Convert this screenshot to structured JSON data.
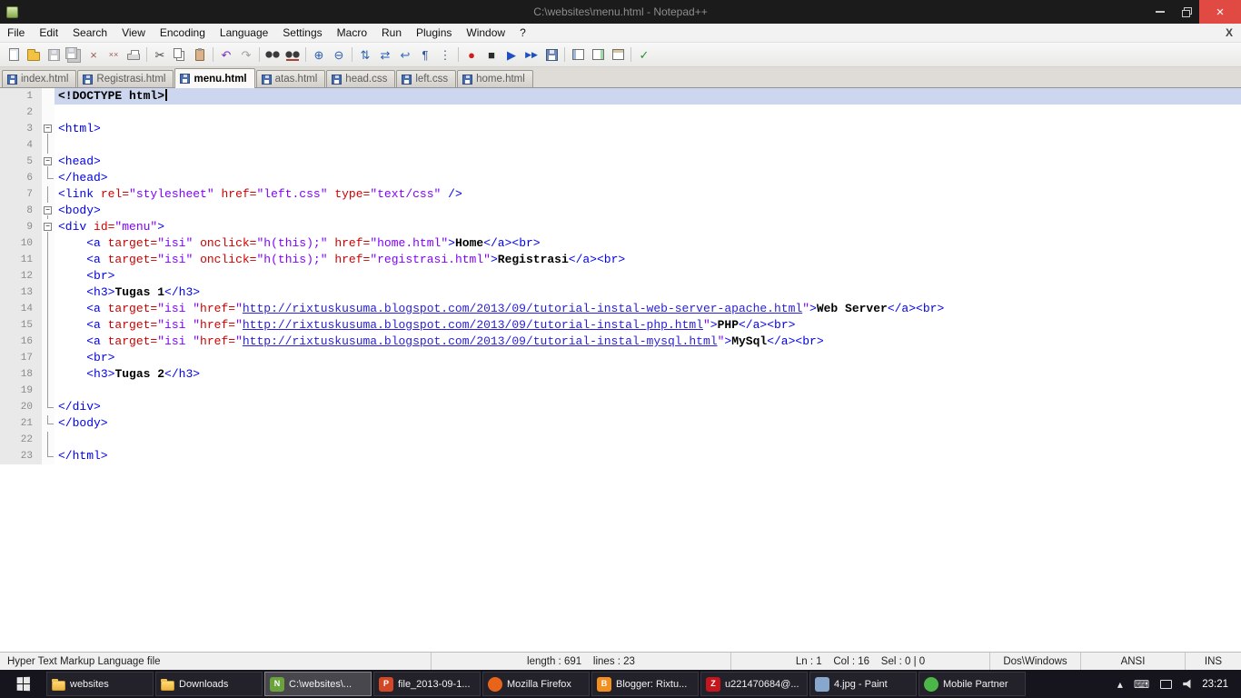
{
  "window": {
    "title": "C:\\websites\\menu.html - Notepad++",
    "menu_close_label": "X"
  },
  "menu": {
    "items": [
      "File",
      "Edit",
      "Search",
      "View",
      "Encoding",
      "Language",
      "Settings",
      "Macro",
      "Run",
      "Plugins",
      "Window",
      "?"
    ]
  },
  "toolbar": {
    "icons": [
      {
        "n": "new-file-icon",
        "s": "page"
      },
      {
        "n": "open-file-icon",
        "s": "folder"
      },
      {
        "n": "save-icon",
        "s": "floppy-gray"
      },
      {
        "n": "save-all-icon",
        "s": "floppy2-gray"
      },
      {
        "n": "close-file-icon",
        "g": "×",
        "c": "#a05a5a"
      },
      {
        "n": "close-all-files-icon",
        "g": "××",
        "c": "#a05a5a"
      },
      {
        "n": "print-icon",
        "s": "printer"
      },
      {
        "sep": true
      },
      {
        "n": "cut-icon",
        "g": "✂",
        "c": "#444444"
      },
      {
        "n": "copy-icon",
        "s": "copy"
      },
      {
        "n": "paste-icon",
        "s": "clipboard"
      },
      {
        "sep": true
      },
      {
        "n": "undo-icon",
        "g": "↶",
        "c": "#7b2fbe"
      },
      {
        "n": "redo-icon",
        "g": "↷",
        "c": "#a0a0a0"
      },
      {
        "sep": true
      },
      {
        "n": "find-icon",
        "s": "binoc"
      },
      {
        "n": "replace-icon",
        "s": "binoc2"
      },
      {
        "sep": true
      },
      {
        "n": "zoom-in-icon",
        "g": "⊕",
        "c": "#2b5fb4"
      },
      {
        "n": "zoom-out-icon",
        "g": "⊖",
        "c": "#2b5fb4"
      },
      {
        "sep": true
      },
      {
        "n": "sync-vertical-icon",
        "g": "⇅",
        "c": "#2b5fb4"
      },
      {
        "n": "sync-horizontal-icon",
        "g": "⇄",
        "c": "#2b5fb4"
      },
      {
        "n": "word-wrap-icon",
        "g": "↩",
        "c": "#356ac0"
      },
      {
        "n": "show-all-characters-icon",
        "g": "¶",
        "c": "#35589a"
      },
      {
        "n": "indent-guide-icon",
        "g": "⋮",
        "c": "#35589a"
      },
      {
        "sep": true
      },
      {
        "n": "start-recording-icon",
        "g": "●",
        "c": "#cf1d1d"
      },
      {
        "n": "stop-recording-icon",
        "g": "■",
        "c": "#2b2b2b"
      },
      {
        "n": "playback-macro-icon",
        "g": "▶",
        "c": "#1d4fc0"
      },
      {
        "n": "run-macro-multiple-icon",
        "g": "▶▶",
        "c": "#1d4fc0"
      },
      {
        "n": "save-macro-icon",
        "s": "floppy"
      },
      {
        "sep": true
      },
      {
        "n": "function-list-icon",
        "s": "panel"
      },
      {
        "n": "document-map-icon",
        "s": "panel2"
      },
      {
        "n": "document-switcher-icon",
        "s": "panel3"
      },
      {
        "sep": true
      },
      {
        "n": "spell-check-icon",
        "g": "✓",
        "c": "#2d8f2d"
      }
    ]
  },
  "tabs": [
    {
      "label": "index.html",
      "active": false
    },
    {
      "label": "Registrasi.html",
      "active": false
    },
    {
      "label": "menu.html",
      "active": true
    },
    {
      "label": "atas.html",
      "active": false
    },
    {
      "label": "head.css",
      "active": false
    },
    {
      "label": "left.css",
      "active": false
    },
    {
      "label": "home.html",
      "active": false
    }
  ],
  "editor": {
    "lines": [
      {
        "n": 1,
        "fold": "none",
        "current": true,
        "caret": true,
        "seg": [
          [
            "<!DOCTYPE html>",
            "doc"
          ]
        ]
      },
      {
        "n": 2,
        "fold": "none",
        "seg": []
      },
      {
        "n": 3,
        "fold": "box",
        "seg": [
          [
            "<html>",
            "tag"
          ]
        ]
      },
      {
        "n": 4,
        "fold": "line",
        "seg": []
      },
      {
        "n": 5,
        "fold": "box",
        "seg": [
          [
            "<head>",
            "tag"
          ]
        ]
      },
      {
        "n": 6,
        "fold": "end",
        "seg": [
          [
            "</head>",
            "tag"
          ]
        ]
      },
      {
        "n": 7,
        "fold": "line",
        "seg": [
          [
            "<link ",
            "tag"
          ],
          [
            "rel=",
            "attr"
          ],
          [
            "\"stylesheet\"",
            "val"
          ],
          [
            " ",
            "pln"
          ],
          [
            "href=",
            "attr"
          ],
          [
            "\"left.css\"",
            "val"
          ],
          [
            " ",
            "pln"
          ],
          [
            "type=",
            "attr"
          ],
          [
            "\"text/css\"",
            "val"
          ],
          [
            " />",
            "tag"
          ]
        ]
      },
      {
        "n": 8,
        "fold": "box",
        "seg": [
          [
            "<body>",
            "tag"
          ]
        ]
      },
      {
        "n": 9,
        "fold": "box",
        "seg": [
          [
            "<div ",
            "tag"
          ],
          [
            "id=",
            "attr"
          ],
          [
            "\"menu\"",
            "val"
          ],
          [
            ">",
            "tag"
          ]
        ]
      },
      {
        "n": 10,
        "fold": "line",
        "seg": [
          [
            "    ",
            "pln"
          ],
          [
            "<a ",
            "tag"
          ],
          [
            "target=",
            "attr"
          ],
          [
            "\"isi\"",
            "val"
          ],
          [
            " ",
            "pln"
          ],
          [
            "onclick=",
            "attr"
          ],
          [
            "\"h(this);\"",
            "val"
          ],
          [
            " ",
            "pln"
          ],
          [
            "href=",
            "attr"
          ],
          [
            "\"home.html\"",
            "val"
          ],
          [
            ">",
            "tag"
          ],
          [
            "Home",
            "txt"
          ],
          [
            "</a>",
            "tag"
          ],
          [
            "<br>",
            "tag"
          ]
        ]
      },
      {
        "n": 11,
        "fold": "line",
        "seg": [
          [
            "    ",
            "pln"
          ],
          [
            "<a ",
            "tag"
          ],
          [
            "target=",
            "attr"
          ],
          [
            "\"isi\"",
            "val"
          ],
          [
            " ",
            "pln"
          ],
          [
            "onclick=",
            "attr"
          ],
          [
            "\"h(this);\"",
            "val"
          ],
          [
            " ",
            "pln"
          ],
          [
            "href=",
            "attr"
          ],
          [
            "\"registrasi.html\"",
            "val"
          ],
          [
            ">",
            "tag"
          ],
          [
            "Registrasi",
            "txt"
          ],
          [
            "</a>",
            "tag"
          ],
          [
            "<br>",
            "tag"
          ]
        ]
      },
      {
        "n": 12,
        "fold": "line",
        "seg": [
          [
            "    ",
            "pln"
          ],
          [
            "<br>",
            "tag"
          ]
        ]
      },
      {
        "n": 13,
        "fold": "line",
        "seg": [
          [
            "    ",
            "pln"
          ],
          [
            "<h3>",
            "tag"
          ],
          [
            "Tugas 1",
            "txt"
          ],
          [
            "</h3>",
            "tag"
          ]
        ]
      },
      {
        "n": 14,
        "fold": "line",
        "seg": [
          [
            "    ",
            "pln"
          ],
          [
            "<a ",
            "tag"
          ],
          [
            "target=",
            "attr"
          ],
          [
            "\"isi \"",
            "val"
          ],
          [
            "href=",
            "attr"
          ],
          [
            "\"",
            "val"
          ],
          [
            "http://rixtuskusuma.blogspot.com/2013/09/tutorial-instal-web-server-apache.html",
            "url"
          ],
          [
            "\"",
            "val"
          ],
          [
            ">",
            "tag"
          ],
          [
            "Web Server",
            "txt"
          ],
          [
            "</a>",
            "tag"
          ],
          [
            "<br>",
            "tag"
          ]
        ]
      },
      {
        "n": 15,
        "fold": "line",
        "seg": [
          [
            "    ",
            "pln"
          ],
          [
            "<a ",
            "tag"
          ],
          [
            "target=",
            "attr"
          ],
          [
            "\"isi \"",
            "val"
          ],
          [
            "href=",
            "attr"
          ],
          [
            "\"",
            "val"
          ],
          [
            "http://rixtuskusuma.blogspot.com/2013/09/tutorial-instal-php.html",
            "url"
          ],
          [
            "\"",
            "val"
          ],
          [
            ">",
            "tag"
          ],
          [
            "PHP",
            "txt"
          ],
          [
            "</a>",
            "tag"
          ],
          [
            "<br>",
            "tag"
          ]
        ]
      },
      {
        "n": 16,
        "fold": "line",
        "seg": [
          [
            "    ",
            "pln"
          ],
          [
            "<a ",
            "tag"
          ],
          [
            "target=",
            "attr"
          ],
          [
            "\"isi \"",
            "val"
          ],
          [
            "href=",
            "attr"
          ],
          [
            "\"",
            "val"
          ],
          [
            "http://rixtuskusuma.blogspot.com/2013/09/tutorial-instal-mysql.html",
            "url"
          ],
          [
            "\"",
            "val"
          ],
          [
            ">",
            "tag"
          ],
          [
            "MySql",
            "txt"
          ],
          [
            "</a>",
            "tag"
          ],
          [
            "<br>",
            "tag"
          ]
        ]
      },
      {
        "n": 17,
        "fold": "line",
        "seg": [
          [
            "    ",
            "pln"
          ],
          [
            "<br>",
            "tag"
          ]
        ]
      },
      {
        "n": 18,
        "fold": "line",
        "seg": [
          [
            "    ",
            "pln"
          ],
          [
            "<h3>",
            "tag"
          ],
          [
            "Tugas 2",
            "txt"
          ],
          [
            "</h3>",
            "tag"
          ]
        ]
      },
      {
        "n": 19,
        "fold": "line",
        "seg": []
      },
      {
        "n": 20,
        "fold": "end",
        "seg": [
          [
            "</div>",
            "tag"
          ]
        ]
      },
      {
        "n": 21,
        "fold": "end",
        "seg": [
          [
            "</body>",
            "tag"
          ]
        ]
      },
      {
        "n": 22,
        "fold": "line",
        "seg": []
      },
      {
        "n": 23,
        "fold": "end",
        "seg": [
          [
            "</html>",
            "tag"
          ]
        ]
      }
    ]
  },
  "statusbar": {
    "doc_type": "Hyper Text Markup Language file",
    "length_lines": "length : 691    lines : 23",
    "position": "Ln : 1    Col : 16    Sel : 0 | 0",
    "eol": "Dos\\Windows",
    "encoding": "ANSI",
    "mode": "INS"
  },
  "taskbar": {
    "items": [
      {
        "label": "websites",
        "icon": {
          "name": "folder-icon",
          "kind": "folder"
        }
      },
      {
        "label": "Downloads",
        "icon": {
          "name": "folder-icon",
          "kind": "folder"
        }
      },
      {
        "label": "C:\\websites\\...",
        "icon": {
          "name": "notepadpp-icon",
          "kind": "square",
          "badge": "N",
          "color": "#6aa33c"
        },
        "active": true
      },
      {
        "label": "file_2013-09-1...",
        "icon": {
          "name": "powerpoint-icon",
          "kind": "square",
          "badge": "P",
          "color": "#d24726"
        }
      },
      {
        "label": "Mozilla Firefox",
        "icon": {
          "name": "firefox-icon",
          "kind": "circle",
          "badge": "",
          "color": "#e8641a"
        }
      },
      {
        "label": "Blogger: Rixtu...",
        "icon": {
          "name": "blogger-icon",
          "kind": "square",
          "badge": "B",
          "color": "#f38f1e"
        }
      },
      {
        "label": "u221470684@...",
        "icon": {
          "name": "filezilla-icon",
          "kind": "square",
          "badge": "Z",
          "color": "#c5161d"
        }
      },
      {
        "label": "4.jpg - Paint",
        "icon": {
          "name": "paint-icon",
          "kind": "square",
          "badge": "",
          "color": "#88a7cc"
        }
      },
      {
        "label": "Mobile Partner",
        "icon": {
          "name": "mobile-partner-icon",
          "kind": "circle",
          "badge": "",
          "color": "#4cb648"
        }
      }
    ],
    "tray": [
      {
        "name": "hidden-icons-chevron",
        "type": "glyph",
        "glyph": "▴"
      },
      {
        "name": "touch-keyboard-icon",
        "type": "glyph",
        "glyph": "⌨"
      },
      {
        "name": "network-icon",
        "type": "shape",
        "shape": "monitor"
      },
      {
        "name": "volume-icon",
        "type": "shape",
        "shape": "speaker"
      }
    ],
    "clock": "23:21"
  }
}
